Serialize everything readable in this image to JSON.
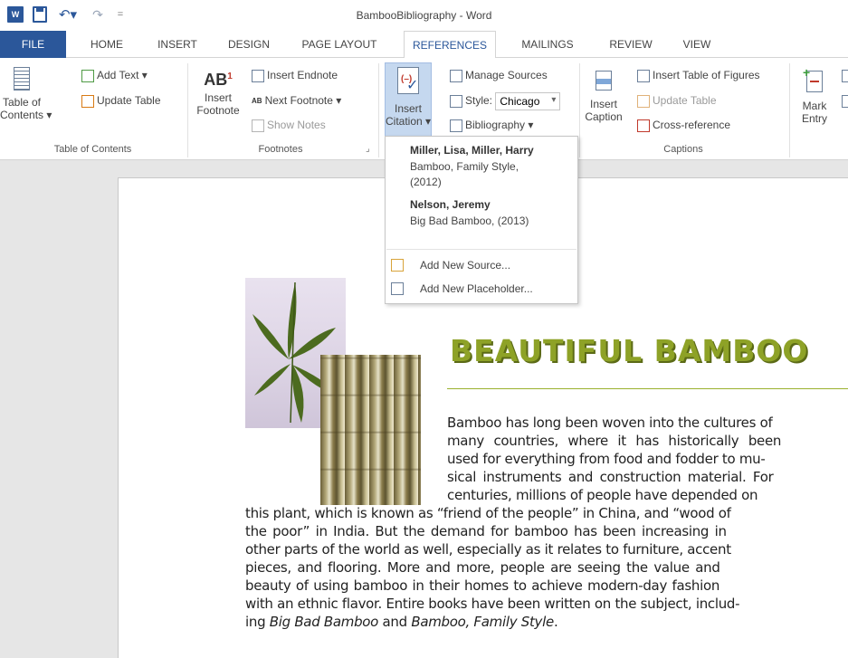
{
  "window": {
    "title": "BambooBibliography - Word",
    "app_icon": "W"
  },
  "quick_access": {
    "undo_glyph": "↶▾",
    "redo_glyph": "↷",
    "customize_glyph": "="
  },
  "tabs": [
    {
      "label": "FILE"
    },
    {
      "label": "HOME"
    },
    {
      "label": "INSERT"
    },
    {
      "label": "DESIGN"
    },
    {
      "label": "PAGE LAYOUT"
    },
    {
      "label": "REFERENCES"
    },
    {
      "label": "MAILINGS"
    },
    {
      "label": "REVIEW"
    },
    {
      "label": "VIEW"
    }
  ],
  "ribbon": {
    "toc": {
      "table_of_contents": "Table of",
      "table_of_contents_2": "Contents ▾",
      "add_text": "Add Text ▾",
      "update_table": "Update Table",
      "group_label": "Table of Contents"
    },
    "footnotes": {
      "insert_footnote": "Insert",
      "insert_footnote_2": "Footnote",
      "ab_label": "AB",
      "ab_sup": "1",
      "insert_endnote": "Insert Endnote",
      "next_footnote": "Next Footnote ▾",
      "show_notes": "Show Notes",
      "group_label": "Footnotes",
      "launcher": "⌟"
    },
    "citations": {
      "insert_citation": "Insert",
      "insert_citation_2": "Citation ▾",
      "manage_sources": "Manage Sources",
      "style_label": "Style:",
      "style_value": "Chicago",
      "bibliography": "Bibliography ▾"
    },
    "captions": {
      "insert_caption": "Insert",
      "insert_caption_2": "Caption",
      "insert_table_of_figures": "Insert Table of Figures",
      "update_table": "Update Table",
      "cross_reference": "Cross-reference",
      "group_label": "Captions"
    },
    "index": {
      "mark_entry": "Mark",
      "mark_entry_2": "Entry"
    }
  },
  "citation_dropdown": {
    "sources": [
      {
        "author": "Miller, Lisa,  Miller, Harry",
        "title_line1": "Bamboo, Family Style,",
        "title_line2": "(2012)"
      },
      {
        "author": "Nelson, Jeremy",
        "title_line1": "Big Bad Bamboo, (2013)"
      }
    ],
    "add_new_source": "Add New Source...",
    "add_new_placeholder": "Add New Placeholder..."
  },
  "document": {
    "heading": "BEAUTIFUL BAMBOO",
    "para_lines": [
      "Bamboo has long been woven into the cultures of",
      "many countries, where it has historically been",
      "used for everything from food and fodder to mu-",
      "sical instruments and construction material. For",
      "centuries, millions of people have depended on",
      "this plant, which is known as “friend of the people” in China, and “wood of",
      "the poor” in India. But the demand for bamboo has been increasing in",
      "other parts of the world as well, especially as it relates to furniture, accent",
      "pieces, and flooring. More and more, people are seeing the value and",
      "beauty of using bamboo in their homes to achieve modern-day fashion",
      "with an ethnic flavor. Entire books have been written on the subject, includ-"
    ],
    "last_line_start": "ing ",
    "last_line_book1": "Big Bad Bamboo",
    "last_line_mid": " and ",
    "last_line_book2": "Bamboo, Family Style",
    "last_line_end": "."
  },
  "colors": {
    "word_blue": "#2b579a",
    "heading_green": "#8ea227"
  }
}
